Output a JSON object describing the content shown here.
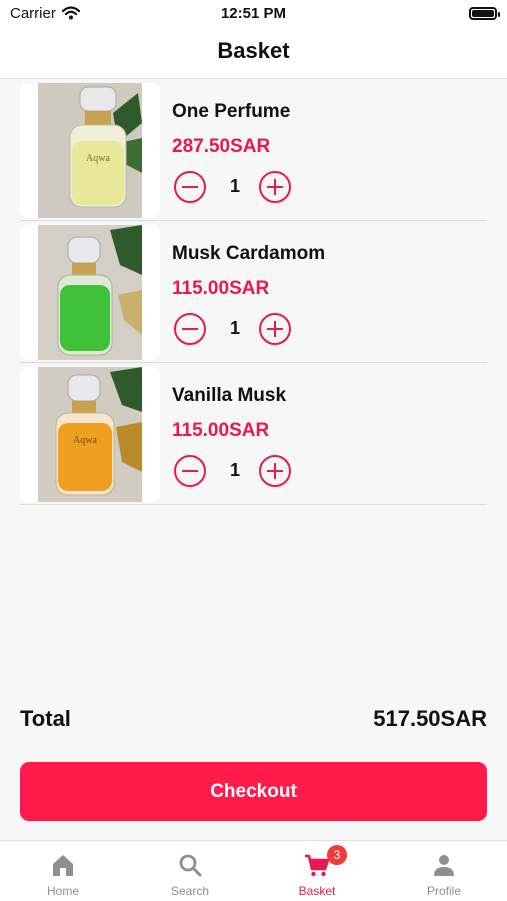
{
  "status_bar": {
    "carrier": "Carrier",
    "time": "12:51 PM"
  },
  "header": {
    "title": "Basket"
  },
  "items": [
    {
      "name": "One Perfume",
      "price": "287.50SAR",
      "quantity": "1",
      "liquid_color": "#e9e79a"
    },
    {
      "name": "Musk Cardamom",
      "price": "115.00SAR",
      "quantity": "1",
      "liquid_color": "#3fc23a"
    },
    {
      "name": "Vanilla Musk",
      "price": "115.00SAR",
      "quantity": "1",
      "liquid_color": "#f0a020"
    }
  ],
  "summary": {
    "total_label": "Total",
    "total_value": "517.50SAR"
  },
  "checkout": {
    "label": "Checkout"
  },
  "tabs": [
    {
      "label": "Home",
      "icon": "home-icon"
    },
    {
      "label": "Search",
      "icon": "search-icon"
    },
    {
      "label": "Basket",
      "icon": "cart-icon",
      "active": true,
      "badge": "3"
    },
    {
      "label": "Profile",
      "icon": "person-icon"
    }
  ],
  "colors": {
    "accent": "#e8194f",
    "button": "#ff1a4b",
    "badge": "#f23a3a"
  }
}
